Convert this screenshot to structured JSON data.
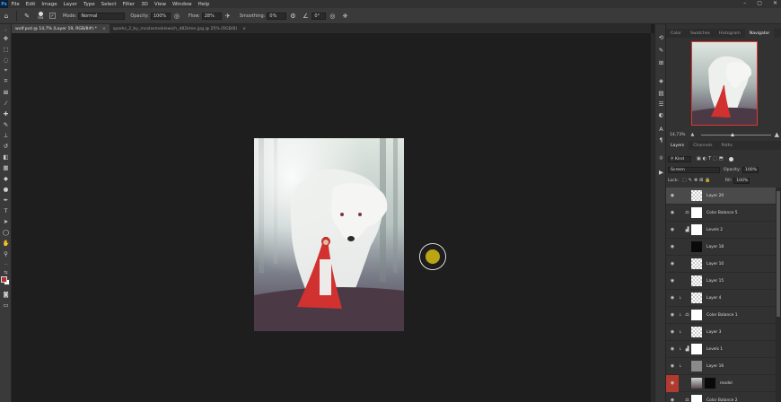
{
  "app": {
    "logo": "Ps"
  },
  "menu": [
    "File",
    "Edit",
    "Image",
    "Layer",
    "Type",
    "Select",
    "Filter",
    "3D",
    "View",
    "Window",
    "Help"
  ],
  "window_controls": [
    "–",
    "▢",
    "✕"
  ],
  "options": {
    "brush_size": "358",
    "mode_label": "Mode:",
    "mode_value": "Normal",
    "opacity_label": "Opacity:",
    "opacity_value": "100%",
    "flow_label": "Flow:",
    "flow_value": "28%",
    "smoothing_label": "Smoothing:",
    "smoothing_value": "0%",
    "angle_value": "0°"
  },
  "tabs": [
    {
      "label": "wolf.psd @ 14,7% (Layer 19, RGB/8#) *",
      "active": true
    },
    {
      "label": "sparks_2_by_mcolasmoklewich_d82kten.jpg @ 25% (RGB/8)",
      "active": false
    }
  ],
  "tab_close": "×",
  "panels": {
    "top_tabs": [
      "Color",
      "Swatches",
      "Histogram",
      "Navigator"
    ],
    "active_top_tab": "Navigator",
    "navigator_zoom": "14,73%",
    "layers_tabs": [
      "Layers",
      "Channels",
      "Paths"
    ],
    "active_layers_tab": "Layers",
    "filter_kind": "Kind",
    "blend_mode": "Screen",
    "opacity_label": "Opacity:",
    "opacity_value": "100%",
    "lock_label": "Lock:",
    "fill_label": "Fill:",
    "fill_value": "100%"
  },
  "layers": [
    {
      "name": "Layer 20",
      "thumb": "checker",
      "selected": true,
      "clip": false,
      "adjustment": false
    },
    {
      "name": "Color Balance 5",
      "thumb": "white",
      "selected": false,
      "clip": false,
      "adjustment": true,
      "adj_icon": "⚖"
    },
    {
      "name": "Levels 2",
      "thumb": "white",
      "selected": false,
      "clip": false,
      "adjustment": true,
      "adj_icon": "▟"
    },
    {
      "name": "Layer 18",
      "thumb": "black",
      "selected": false,
      "clip": false,
      "adjustment": false
    },
    {
      "name": "Layer 10",
      "thumb": "checker",
      "selected": false,
      "clip": false,
      "adjustment": false
    },
    {
      "name": "Layer 15",
      "thumb": "checker",
      "selected": false,
      "clip": false,
      "adjustment": false
    },
    {
      "name": "Layer 4",
      "thumb": "checker",
      "selected": false,
      "clip": true,
      "adjustment": false
    },
    {
      "name": "Color Balance 1",
      "thumb": "white",
      "selected": false,
      "clip": true,
      "adjustment": true,
      "adj_icon": "⚖"
    },
    {
      "name": "Layer 3",
      "thumb": "checker",
      "selected": false,
      "clip": true,
      "adjustment": false
    },
    {
      "name": "Levels 1",
      "thumb": "white",
      "selected": false,
      "clip": true,
      "adjustment": true,
      "adj_icon": "▟"
    },
    {
      "name": "Layer 16",
      "thumb": "grey",
      "selected": false,
      "clip": true,
      "adjustment": false
    },
    {
      "name": "model",
      "thumb": "photo",
      "selected": false,
      "clip": false,
      "adjustment": false,
      "eye_red": true
    },
    {
      "name": "Color Balance 2",
      "thumb": "white",
      "selected": false,
      "clip": false,
      "adjustment": true,
      "adj_icon": "⚖"
    }
  ],
  "colors": {
    "brush_cursor": "#bba514",
    "foreground": "#b03030",
    "background": "#ffffff",
    "nav_box": "#e0372e"
  }
}
